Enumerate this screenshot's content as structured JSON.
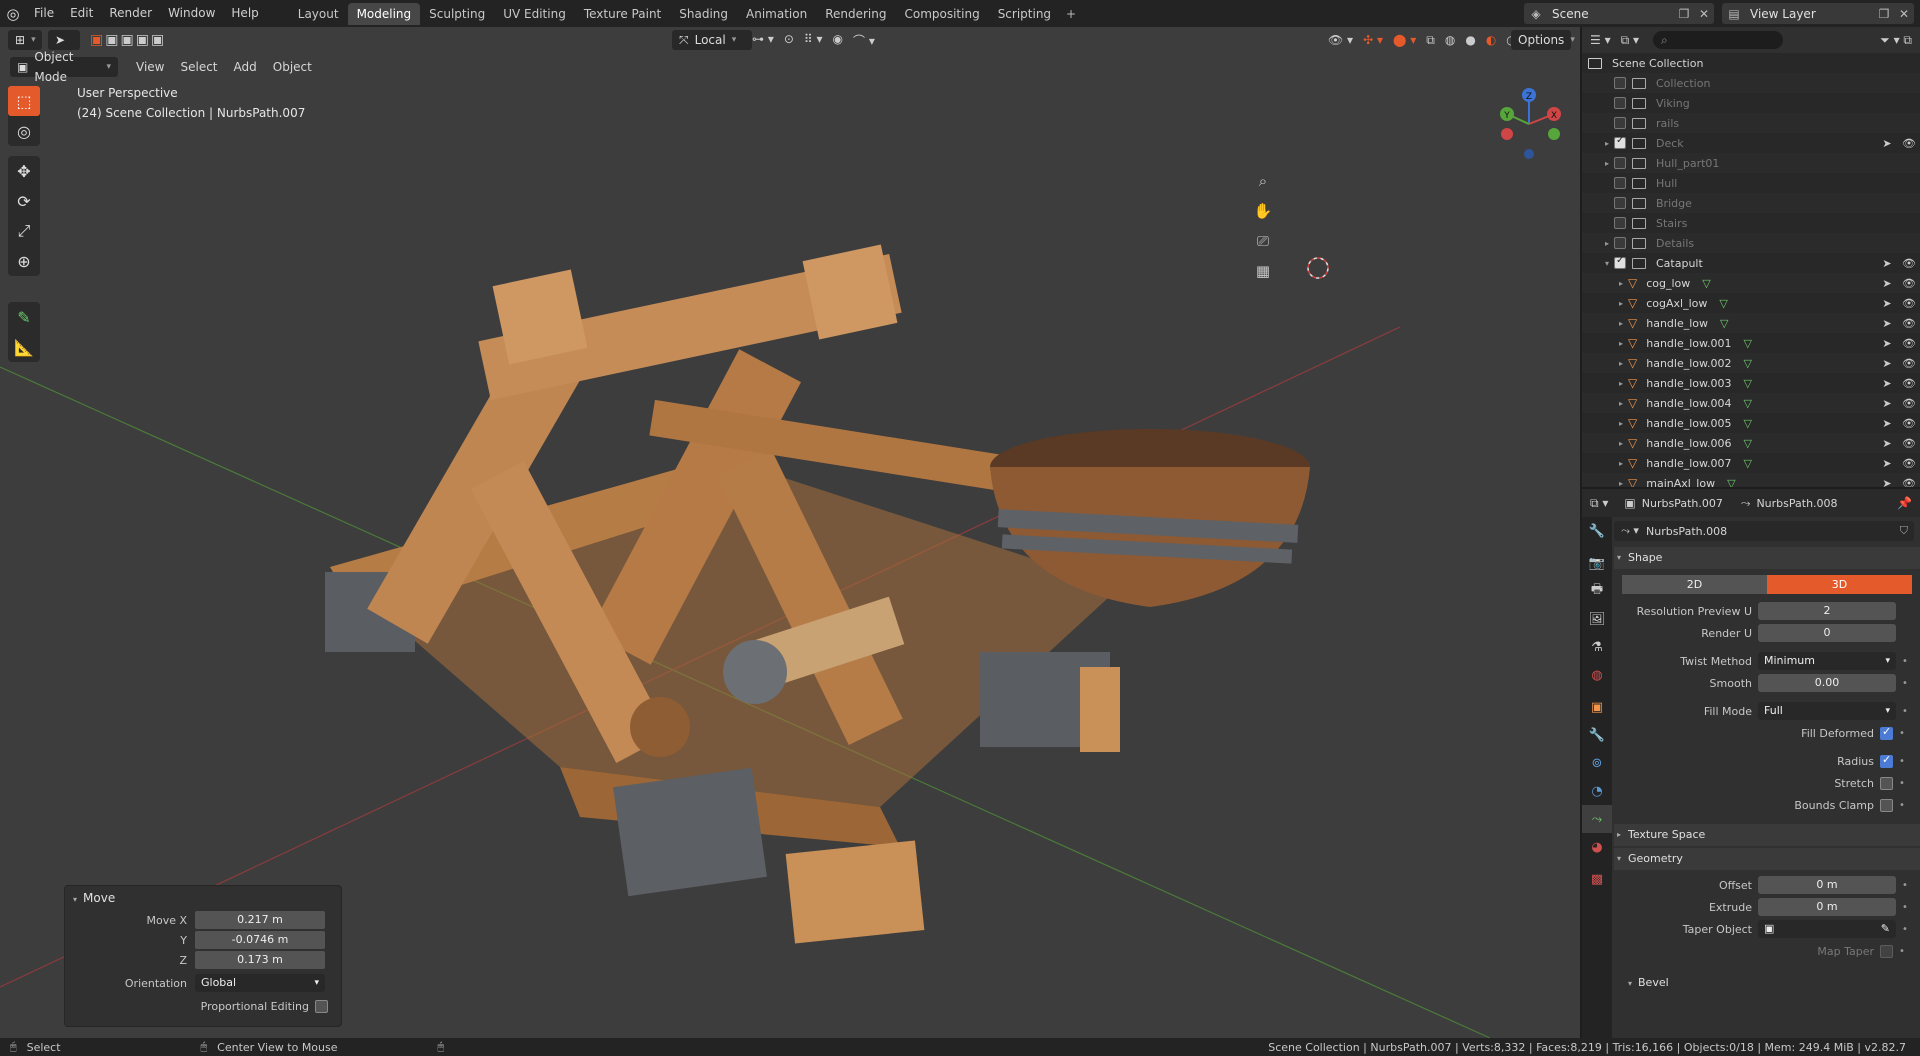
{
  "topbar": {
    "menus": [
      "File",
      "Edit",
      "Render",
      "Window",
      "Help"
    ],
    "workspaces": [
      "Layout",
      "Modeling",
      "Sculpting",
      "UV Editing",
      "Texture Paint",
      "Shading",
      "Animation",
      "Rendering",
      "Compositing",
      "Scripting"
    ],
    "active_workspace": "Modeling",
    "scene": "Scene",
    "view_layer": "View Layer"
  },
  "viewport": {
    "mode": "Object Mode",
    "menus": [
      "View",
      "Select",
      "Add",
      "Object"
    ],
    "transform_orientation": "Local",
    "options_label": "Options",
    "perspective_label": "User Perspective",
    "context_label": "(24) Scene Collection | NurbsPath.007",
    "gizmo": {
      "x": "X",
      "y": "Y",
      "z": "Z"
    }
  },
  "operator_panel": {
    "title": "Move",
    "move_x_label": "Move X",
    "move_x": "0.217 m",
    "y_label": "Y",
    "y": "-0.0746 m",
    "z_label": "Z",
    "z": "0.173 m",
    "orientation_label": "Orientation",
    "orientation": "Global",
    "proportional_label": "Proportional Editing"
  },
  "outliner": {
    "root": "Scene Collection",
    "rows": [
      {
        "name": "Collection",
        "type": "collection",
        "checked": false,
        "dim": true,
        "arrow": ""
      },
      {
        "name": "Viking",
        "type": "collection",
        "checked": false,
        "dim": true,
        "arrow": ""
      },
      {
        "name": "rails",
        "type": "collection",
        "checked": false,
        "dim": true,
        "arrow": ""
      },
      {
        "name": "Deck",
        "type": "collection",
        "checked": true,
        "dim": true,
        "arrow": "▸"
      },
      {
        "name": "Hull_part01",
        "type": "collection",
        "checked": false,
        "dim": true,
        "arrow": "▸"
      },
      {
        "name": "Hull",
        "type": "collection",
        "checked": false,
        "dim": true,
        "arrow": ""
      },
      {
        "name": "Bridge",
        "type": "collection",
        "checked": false,
        "dim": true,
        "arrow": ""
      },
      {
        "name": "Stairs",
        "type": "collection",
        "checked": false,
        "dim": true,
        "arrow": ""
      },
      {
        "name": "Details",
        "type": "collection",
        "checked": false,
        "dim": true,
        "arrow": "▸"
      },
      {
        "name": "Catapult",
        "type": "collection",
        "checked": true,
        "dim": false,
        "arrow": "▾"
      },
      {
        "name": "cog_low",
        "type": "mesh",
        "checked": false,
        "dim": false,
        "arrow": "▸"
      },
      {
        "name": "cogAxl_low",
        "type": "mesh",
        "checked": false,
        "dim": false,
        "arrow": "▸"
      },
      {
        "name": "handle_low",
        "type": "mesh",
        "checked": false,
        "dim": false,
        "arrow": "▸"
      },
      {
        "name": "handle_low.001",
        "type": "mesh",
        "checked": false,
        "dim": false,
        "arrow": "▸"
      },
      {
        "name": "handle_low.002",
        "type": "mesh",
        "checked": false,
        "dim": false,
        "arrow": "▸"
      },
      {
        "name": "handle_low.003",
        "type": "mesh",
        "checked": false,
        "dim": false,
        "arrow": "▸"
      },
      {
        "name": "handle_low.004",
        "type": "mesh",
        "checked": false,
        "dim": false,
        "arrow": "▸"
      },
      {
        "name": "handle_low.005",
        "type": "mesh",
        "checked": false,
        "dim": false,
        "arrow": "▸"
      },
      {
        "name": "handle_low.006",
        "type": "mesh",
        "checked": false,
        "dim": false,
        "arrow": "▸"
      },
      {
        "name": "handle_low.007",
        "type": "mesh",
        "checked": false,
        "dim": false,
        "arrow": "▸"
      },
      {
        "name": "mainAxl_low",
        "type": "mesh",
        "checked": false,
        "dim": false,
        "arrow": "▸"
      }
    ]
  },
  "properties": {
    "object_name": "NurbsPath.007",
    "data_name": "NurbsPath.008",
    "datablock": "NurbsPath.008",
    "shape_title": "Shape",
    "dim_2d": "2D",
    "dim_3d": "3D",
    "resolution_preview_label": "Resolution Preview U",
    "resolution_preview": "2",
    "render_u_label": "Render U",
    "render_u": "0",
    "twist_method_label": "Twist Method",
    "twist_method": "Minimum",
    "smooth_label": "Smooth",
    "smooth": "0.00",
    "fill_mode_label": "Fill Mode",
    "fill_mode": "Full",
    "fill_deformed_label": "Fill Deformed",
    "radius_label": "Radius",
    "stretch_label": "Stretch",
    "bounds_clamp_label": "Bounds Clamp",
    "texture_space_title": "Texture Space",
    "geometry_title": "Geometry",
    "offset_label": "Offset",
    "offset": "0 m",
    "extrude_label": "Extrude",
    "extrude": "0 m",
    "taper_label": "Taper Object",
    "map_taper_label": "Map Taper",
    "bevel_title": "Bevel"
  },
  "statusbar": {
    "select": "Select",
    "center_view": "Center View to Mouse",
    "stats": "Scene Collection | NurbsPath.007 | Verts:8,332 | Faces:8,219 | Tris:16,166 | Objects:0/18 | Mem: 249.4 MiB | v2.82.7"
  }
}
